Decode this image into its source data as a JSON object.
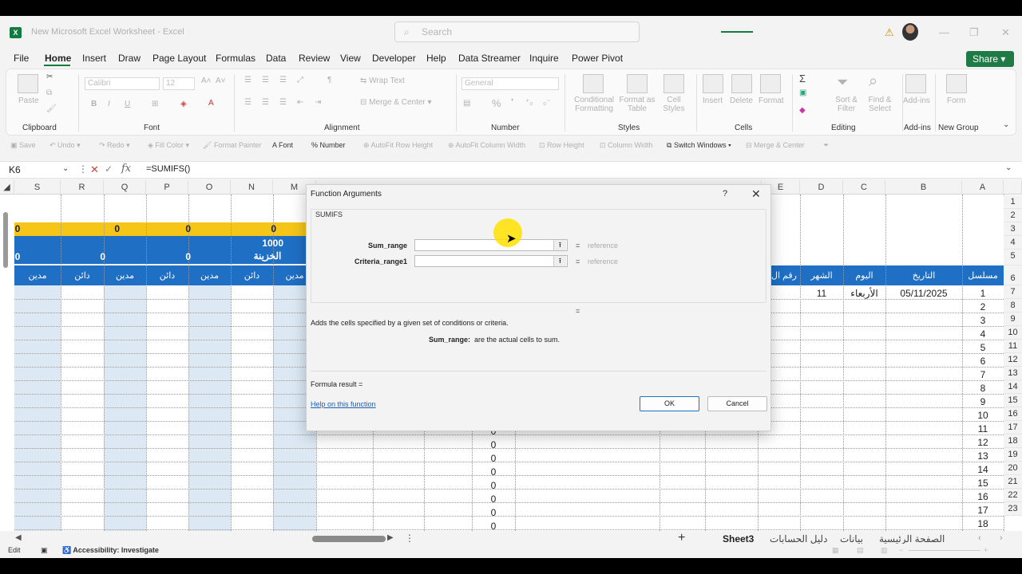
{
  "window": {
    "title": "New Microsoft Excel Worksheet  -  Excel",
    "search_placeholder": "Search",
    "logo": "X",
    "share_label": "Share"
  },
  "menu": [
    "File",
    "Home",
    "Insert",
    "Draw",
    "Page Layout",
    "Formulas",
    "Data",
    "Review",
    "View",
    "Developer",
    "Help",
    "Data Streamer",
    "Inquire",
    "Power Pivot"
  ],
  "ribbon": {
    "groups": [
      "Clipboard",
      "Font",
      "Alignment",
      "Number",
      "Styles",
      "Cells",
      "Editing",
      "Add-ins",
      "New Group"
    ],
    "paste": "Paste",
    "font_name": "Calibri",
    "font_size": "12",
    "wrap_text": "Wrap Text",
    "merge_center": "Merge & Center",
    "number_format": "General",
    "cond_format": "Conditional Formatting",
    "format_table": "Format as Table",
    "cell_styles": "Cell Styles",
    "insert": "Insert",
    "delete": "Delete",
    "format": "Format",
    "sort_filter": "Sort & Filter",
    "find_select": "Find & Select",
    "addins": "Add-ins",
    "form": "Form"
  },
  "quick_toolbar": [
    "Save",
    "Undo",
    "Redo",
    "Fill Color",
    "Format Painter",
    "Font",
    "Number",
    "AutoFit Row Height",
    "AutoFit Column Width",
    "Row Height",
    "Column Width",
    "Switch Windows",
    "Merge & Center"
  ],
  "formula_bar": {
    "name_box": "K6",
    "formula": "=SUMIFS()"
  },
  "columns_left": [
    "S",
    "R",
    "Q",
    "P",
    "O",
    "N",
    "M"
  ],
  "columns_right": [
    "E",
    "D",
    "C",
    "B",
    "A"
  ],
  "rows": [
    "1",
    "2",
    "3",
    "4",
    "5",
    "6",
    "7",
    "8",
    "9",
    "10",
    "11",
    "12",
    "13",
    "14",
    "15",
    "16",
    "17",
    "18",
    "19",
    "20",
    "21",
    "22",
    "23"
  ],
  "sheet_left": {
    "row2": [
      "0",
      "0",
      "0",
      "0"
    ],
    "row3_value": "1000",
    "row4": [
      "0",
      "0",
      "0"
    ],
    "row4_label": "الخزينة",
    "headers": [
      "مدين",
      "دائن",
      "مدين",
      "دائن",
      "مدين",
      "دائن",
      "مدين"
    ]
  },
  "sheet_right": {
    "headers": [
      "رقم ال",
      "الشهر",
      "اليوم",
      "التاريخ",
      "مسلسل"
    ],
    "row6": {
      "month": "11",
      "day": "الأربعاء",
      "date": "05/11/2025",
      "serial": "1"
    },
    "serials": [
      "2",
      "3",
      "4",
      "5",
      "6",
      "7",
      "8",
      "9",
      "10",
      "11",
      "12",
      "13",
      "14",
      "15",
      "16",
      "17",
      "18"
    ]
  },
  "zero_column": [
    "0",
    "0",
    "0",
    "0",
    "0",
    "0",
    "0",
    "0"
  ],
  "dialog": {
    "title": "Function Arguments",
    "help_q": "?",
    "close": "✕",
    "function_name": "SUMIFS",
    "arg1_label": "Sum_range",
    "arg2_label": "Criteria_range1",
    "eq": "=",
    "ref": "reference",
    "description": "Adds the cells specified by a given set of conditions or criteria.",
    "arg_desc_label": "Sum_range:",
    "arg_desc": "are the actual cells to sum.",
    "formula_result": "Formula result =",
    "help_link": "Help on this function",
    "ok": "OK",
    "cancel": "Cancel"
  },
  "tabs": [
    "Sheet3",
    "دليل الحسابات",
    "بيانات",
    "الصفحة الرئيسية"
  ],
  "status": {
    "mode": "Edit",
    "accessibility": "Accessibility: Investigate"
  },
  "colors": {
    "excel_green": "#107c41",
    "header_blue": "#1f6fc5",
    "yellow_fill": "#f5c518",
    "light_blue_fill": "#dce9f5"
  }
}
